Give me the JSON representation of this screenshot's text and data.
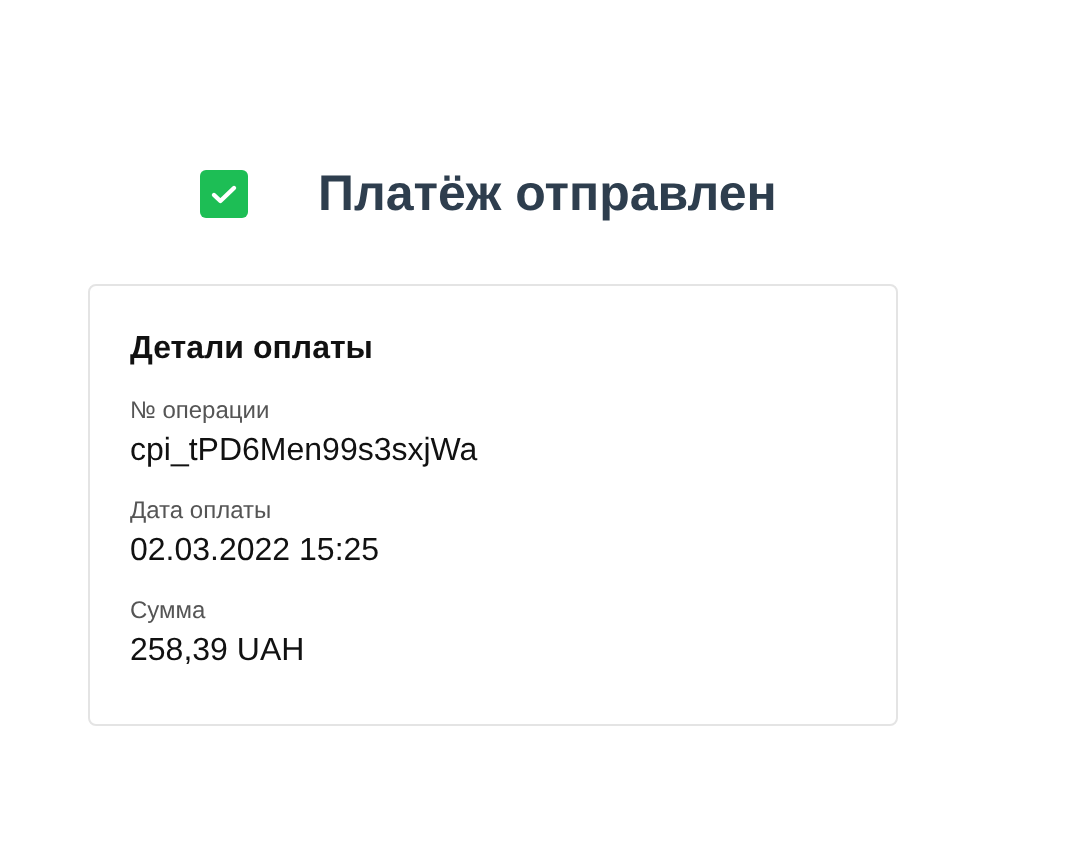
{
  "header": {
    "checked": true,
    "title": "Платёж отправлен"
  },
  "details": {
    "title": "Детали оплаты",
    "fields": [
      {
        "label": "№ операции",
        "value": "cpi_tPD6Men99s3sxjWa"
      },
      {
        "label": "Дата оплаты",
        "value": "02.03.2022 15:25"
      },
      {
        "label": "Сумма",
        "value": "258,39 UAH"
      }
    ]
  }
}
